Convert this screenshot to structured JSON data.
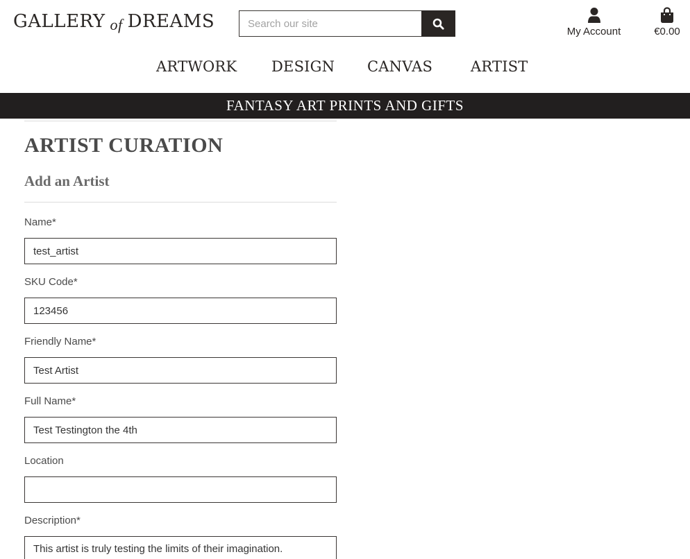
{
  "header": {
    "logo": {
      "part1": "GALLERY",
      "part2": "of",
      "part3": "DREAMS"
    },
    "search": {
      "placeholder": "Search our site",
      "value": ""
    },
    "account_label": "My Account",
    "bag_total": "€0.00"
  },
  "nav": {
    "items": [
      "ARTWORK",
      "DESIGN",
      "CANVAS",
      "ARTIST"
    ]
  },
  "banner": "FANTASY ART PRINTS AND GIFTS",
  "page": {
    "title": "ARTIST CURATION",
    "subtitle": "Add an Artist"
  },
  "form": {
    "fields": [
      {
        "label": "Name*",
        "value": "test_artist"
      },
      {
        "label": "SKU Code*",
        "value": "123456"
      },
      {
        "label": "Friendly Name*",
        "value": "Test Artist"
      },
      {
        "label": "Full Name*",
        "value": "Test Testington the 4th"
      },
      {
        "label": "Location",
        "value": ""
      },
      {
        "label": "Description*",
        "value": "This artist is truly testing the limits of their imagination."
      }
    ]
  },
  "icons": {
    "search": "search-icon",
    "account": "user-icon",
    "bag": "shopping-bag-icon"
  },
  "colors": {
    "dark": "#221f1f",
    "text": "#4a4a4a",
    "border": "#3a3634"
  }
}
